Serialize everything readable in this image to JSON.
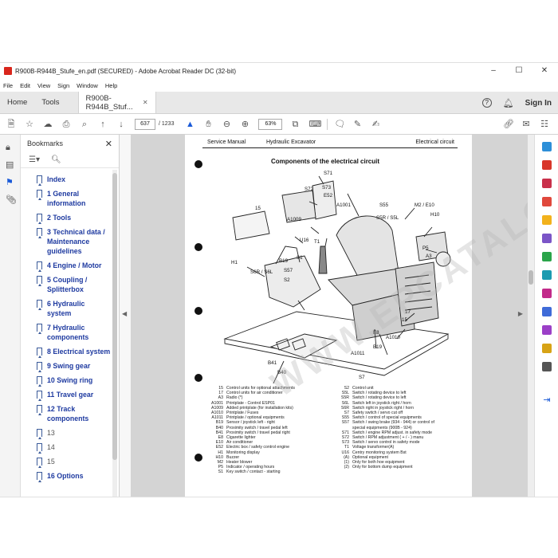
{
  "window": {
    "title": "R900B-R944B_Stufe_en.pdf (SECURED) - Adobe Acrobat Reader DC (32-bit)",
    "controls": [
      "–",
      "☐",
      "✕"
    ]
  },
  "menu": [
    "File",
    "Edit",
    "View",
    "Sign",
    "Window",
    "Help"
  ],
  "tabs": {
    "home": "Home",
    "tools": "Tools",
    "document": "R900B-R944B_Stuf...",
    "close": "✕",
    "sign_in": "Sign In"
  },
  "toolbar": {
    "page_current": "637",
    "page_total": "/ 1233",
    "zoom": "63%"
  },
  "bookmarks": {
    "title": "Bookmarks",
    "items": [
      {
        "label": "Index",
        "style": "bold"
      },
      {
        "label": "1 General information",
        "style": "bold"
      },
      {
        "label": "2 Tools",
        "style": "bold"
      },
      {
        "label": "3 Technical data / Maintenance guidelines",
        "style": "bold"
      },
      {
        "label": "4 Engine / Motor",
        "style": "bold"
      },
      {
        "label": "5 Coupling / Splitterbox",
        "style": "bold"
      },
      {
        "label": "6 Hydraulic system",
        "style": "bold"
      },
      {
        "label": "7 Hydraulic components",
        "style": "bold"
      },
      {
        "label": "8 Electrical system",
        "style": "bold"
      },
      {
        "label": "9 Swing gear",
        "style": "bold"
      },
      {
        "label": "10 Swing ring",
        "style": "bold"
      },
      {
        "label": "11 Travel gear",
        "style": "bold"
      },
      {
        "label": "12 Track components",
        "style": "bold"
      },
      {
        "label": "13",
        "style": "plain"
      },
      {
        "label": "14",
        "style": "plain"
      },
      {
        "label": "15",
        "style": "plain"
      },
      {
        "label": "16 Options",
        "style": "bold"
      }
    ]
  },
  "page": {
    "header_left": "Service Manual",
    "header_mid": "Hydraulic Excavator",
    "header_right": "Electrical circuit",
    "title": "Components of the electrical circuit",
    "watermark": "WWW.EPCATALOGS.COM",
    "callouts": [
      "S71",
      "S72",
      "S73",
      "E52",
      "A1001",
      "A1009",
      "15",
      "U16",
      "T1",
      "S55",
      "S5R / S5L",
      "M2 / E10",
      "H10",
      "P5",
      "A3",
      "S6R / S6L",
      "B19",
      "S1",
      "S57",
      "S2",
      "H1",
      "17",
      "15",
      "A1010",
      "E8",
      "B19",
      "A1011",
      "S7",
      "B41",
      "B40"
    ],
    "legend_left": [
      [
        "15",
        "Control units for optional attachments"
      ],
      [
        "17",
        "Control units for air conditioner"
      ],
      [
        "A3",
        "Radio (*)"
      ],
      [
        "A1001",
        "Printplate - Control ESP01"
      ],
      [
        "A1009",
        "Added printplate (for installation kits)"
      ],
      [
        "A1010",
        "Printplate / Fuses"
      ],
      [
        "A1011",
        "Printplate / optional equipments"
      ],
      [
        "B19",
        "Sensor / joystick left - right"
      ],
      [
        "B40",
        "Proximity switch / travel pedal left"
      ],
      [
        "B41",
        "Proximity switch / travel pedal right"
      ],
      [
        "E8",
        "Cigarette lighter"
      ],
      [
        "E10",
        "Air conditioner"
      ],
      [
        "E52",
        "Electric box / safety control engine"
      ],
      [
        "H1",
        "Monitoring display"
      ],
      [
        "H10",
        "Buzzer"
      ],
      [
        "M2",
        "Heater blower"
      ],
      [
        "P5",
        "Indicator / operating hours"
      ],
      [
        "S1",
        "Key switch / contact - starting"
      ]
    ],
    "legend_right": [
      [
        "S2",
        "Control unit"
      ],
      [
        "S5L",
        "Switch / rotating device to left"
      ],
      [
        "S5R",
        "Switch / rotating device to left"
      ],
      [
        "S6L",
        "Switch left in joystick right / horn"
      ],
      [
        "S6R",
        "Switch right in joystick right / horn"
      ],
      [
        "S7",
        "Safety switch / servo cut off"
      ],
      [
        "S55",
        "Switch / control of special equipments"
      ],
      [
        "S57",
        "Switch / swing brake (934 - 944) or control of"
      ],
      [
        "",
        "special equipments (900B - 924)"
      ],
      [
        "S71",
        "Switch / engine RPM adjust. in safety mode"
      ],
      [
        "S72",
        "Switch / RPM adjustment ( + / - ) manu"
      ],
      [
        "S73",
        "Switch / servo control in safety mode"
      ],
      [
        "T1",
        "Voltage transformer(A)"
      ],
      [
        "U16",
        "Centry monitoring system Bst"
      ],
      [
        "",
        ""
      ],
      [
        "(A)",
        "Optional equipment"
      ],
      [
        "(1)",
        "Only for both hoe equipment"
      ],
      [
        "(2)",
        "Only for bottom dump equipment"
      ]
    ]
  }
}
